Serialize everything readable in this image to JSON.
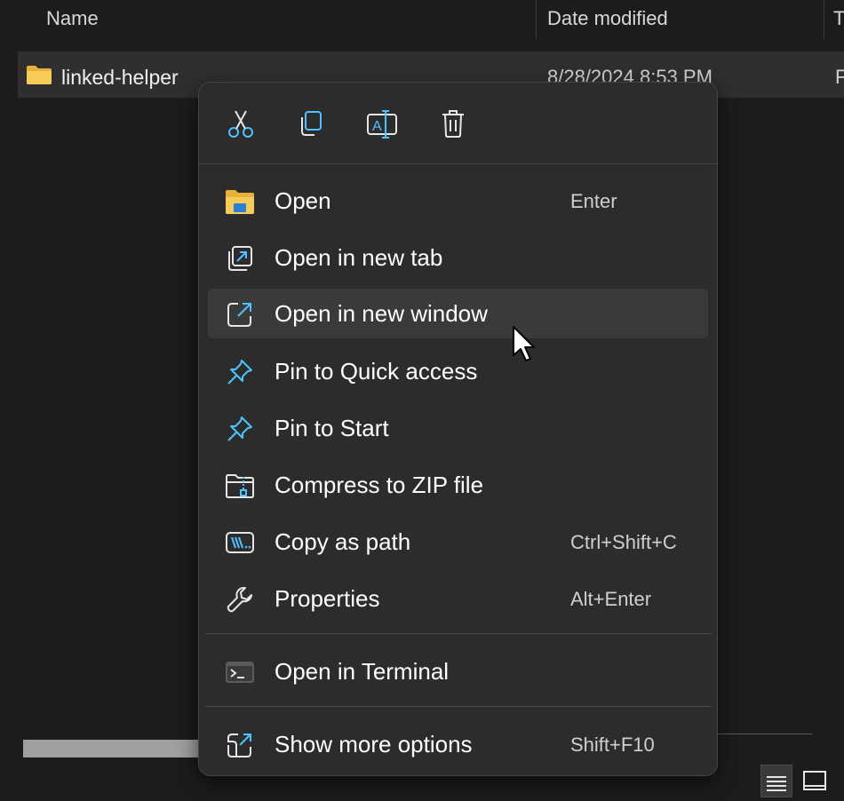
{
  "explorer": {
    "columns": {
      "name": "Name",
      "date_modified": "Date modified",
      "type_clip": "T"
    },
    "file": {
      "name": "linked-helper",
      "date_modified": "8/28/2024 8:53 PM",
      "type_clip": "F"
    }
  },
  "context_menu": {
    "quick_actions": [
      {
        "icon": "cut-icon",
        "label": "Cut"
      },
      {
        "icon": "copy-icon",
        "label": "Copy"
      },
      {
        "icon": "rename-icon",
        "label": "Rename"
      },
      {
        "icon": "delete-icon",
        "label": "Delete"
      }
    ],
    "items": [
      {
        "label": "Open",
        "shortcut": "Enter",
        "icon": "folder-open-icon"
      },
      {
        "label": "Open in new tab",
        "shortcut": "",
        "icon": "new-tab-icon"
      },
      {
        "label": "Open in new window",
        "shortcut": "",
        "icon": "new-window-icon",
        "state": "hover"
      },
      {
        "label": "Pin to Quick access",
        "shortcut": "",
        "icon": "pin-icon"
      },
      {
        "label": "Pin to Start",
        "shortcut": "",
        "icon": "pin-icon"
      },
      {
        "label": "Compress to ZIP file",
        "shortcut": "",
        "icon": "zip-folder-icon"
      },
      {
        "label": "Copy as path",
        "shortcut": "Ctrl+Shift+C",
        "icon": "copy-path-icon"
      },
      {
        "label": "Properties",
        "shortcut": "Alt+Enter",
        "icon": "wrench-icon"
      },
      {
        "label": "Open in Terminal",
        "shortcut": "",
        "icon": "terminal-icon"
      },
      {
        "label": "Show more options",
        "shortcut": "Shift+F10",
        "icon": "more-options-icon"
      }
    ]
  },
  "colors": {
    "accent": "#4cc2ff",
    "menu_bg": "#2c2c2c",
    "hover_bg": "#3a3a3a",
    "folder": "#f4c54e"
  }
}
